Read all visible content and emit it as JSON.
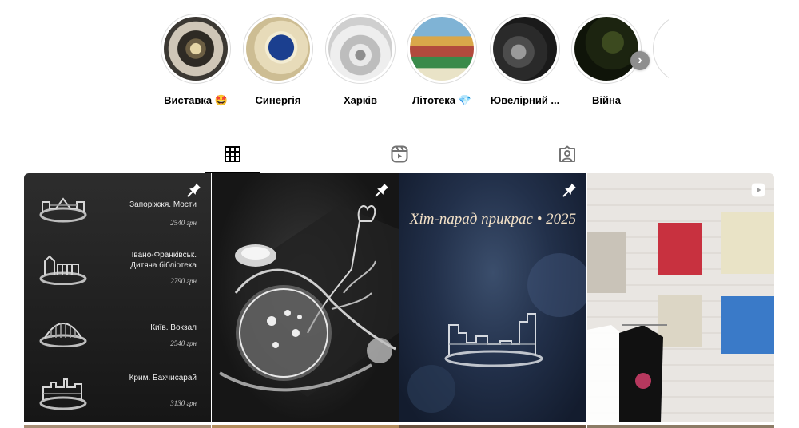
{
  "highlights": [
    {
      "label": "Виставка 🤩"
    },
    {
      "label": "Синергія"
    },
    {
      "label": "Харків"
    },
    {
      "label": "Літотека 💎"
    },
    {
      "label": "Ювелірний ..."
    },
    {
      "label": "Війна"
    }
  ],
  "tabs": [
    {
      "name": "posts",
      "icon": "grid-icon",
      "active": true
    },
    {
      "name": "reels",
      "icon": "reels-icon",
      "active": false
    },
    {
      "name": "tagged",
      "icon": "tagged-icon",
      "active": false
    }
  ],
  "posts": {
    "post1": {
      "items": [
        {
          "name": "Запоріжжя. Мости",
          "price": "2540 грн"
        },
        {
          "name": "Івано-Франківськ. Дитяча бібліотека",
          "price": "2790 грн"
        },
        {
          "name": "Київ. Вокзал",
          "price": "2540 грн"
        },
        {
          "name": "Крим. Бахчисарай",
          "price": "3130 грн"
        }
      ]
    },
    "post3": {
      "title": "Хіт-парад прикрас • 2025"
    }
  },
  "colors": {
    "active_tab": "#000000",
    "inactive_icon": "#737373",
    "ring": "#dbdbdb"
  }
}
